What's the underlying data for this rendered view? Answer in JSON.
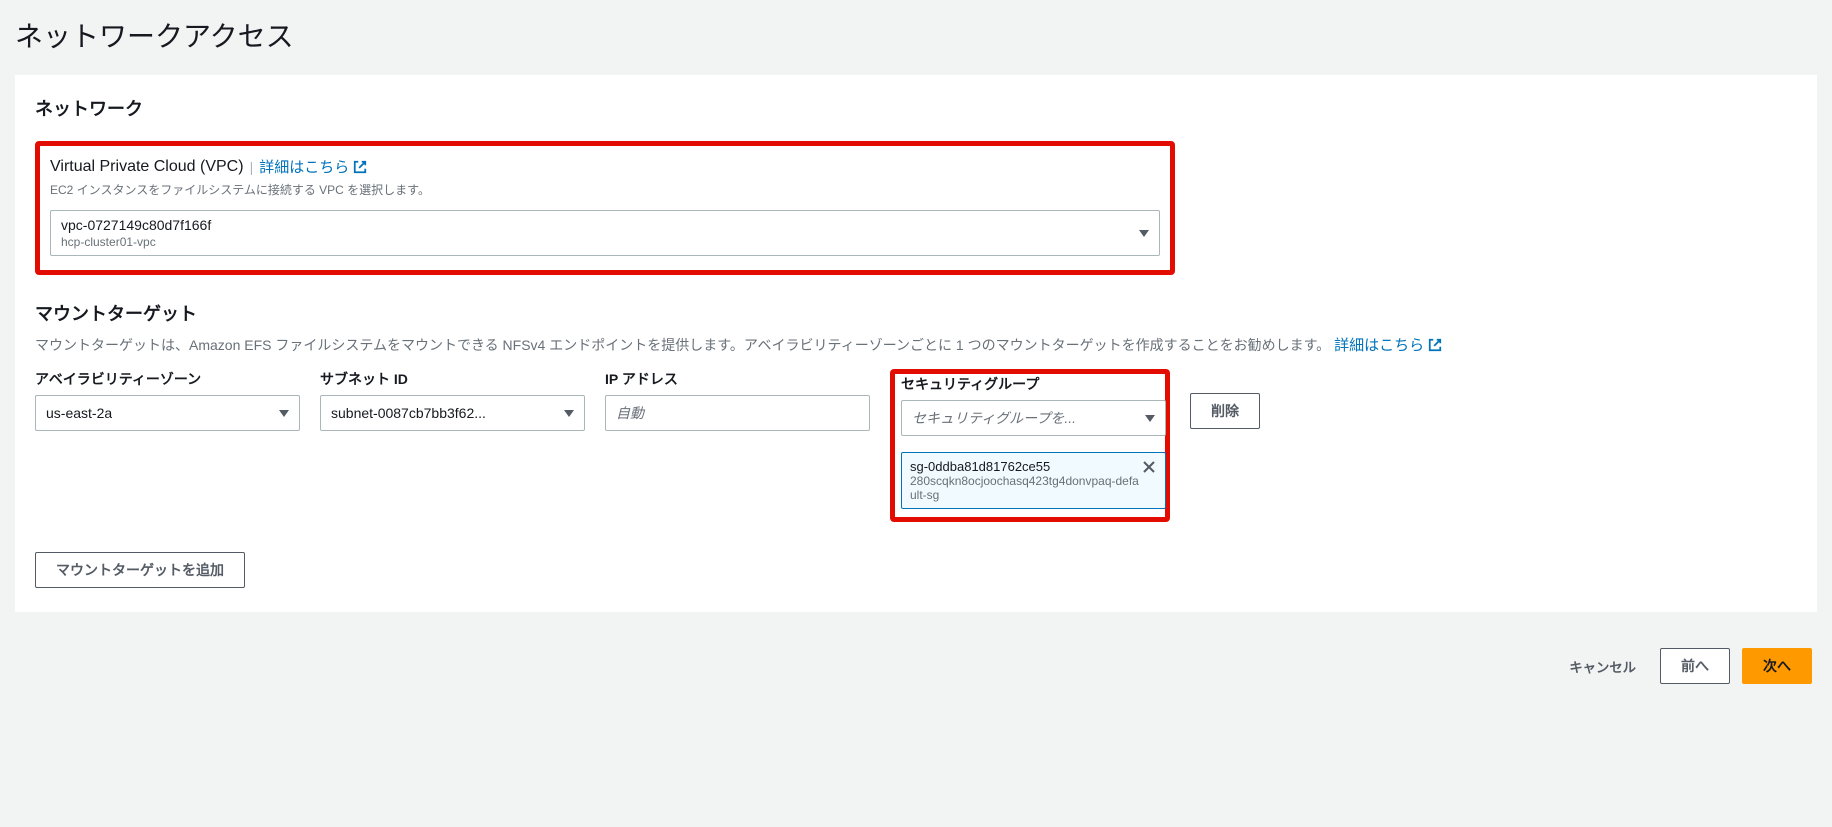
{
  "page": {
    "title": "ネットワークアクセス"
  },
  "network": {
    "section_title": "ネットワーク",
    "vpc_label": "Virtual Private Cloud (VPC)",
    "learn_more": "詳細はこちら",
    "helper_text": "EC2 インスタンスをファイルシステムに接続する VPC を選択します。",
    "selected_vpc_id": "vpc-0727149c80d7f166f",
    "selected_vpc_name": "hcp-cluster01-vpc"
  },
  "mount": {
    "section_title": "マウントターゲット",
    "description": "マウントターゲットは、Amazon EFS ファイルシステムをマウントできる NFSv4 エンドポイントを提供します。アベイラビリティーゾーンごとに 1 つのマウントターゲットを作成することをお勧めします。",
    "learn_more": "詳細はこちら",
    "headers": {
      "az": "アベイラビリティーゾーン",
      "subnet": "サブネット ID",
      "ip": "IP アドレス",
      "sg": "セキュリティグループ"
    },
    "row": {
      "az_value": "us-east-2a",
      "subnet_value": "subnet-0087cb7bb3f62...",
      "ip_placeholder": "自動",
      "sg_placeholder": "セキュリティグループを...",
      "sg_token_id": "sg-0ddba81d81762ce55",
      "sg_token_name": "280scqkn8ocjoochasq423tg4donvpaq-default-sg",
      "delete_label": "削除"
    },
    "add_target_label": "マウントターゲットを追加"
  },
  "footer": {
    "cancel": "キャンセル",
    "prev": "前へ",
    "next": "次へ"
  }
}
